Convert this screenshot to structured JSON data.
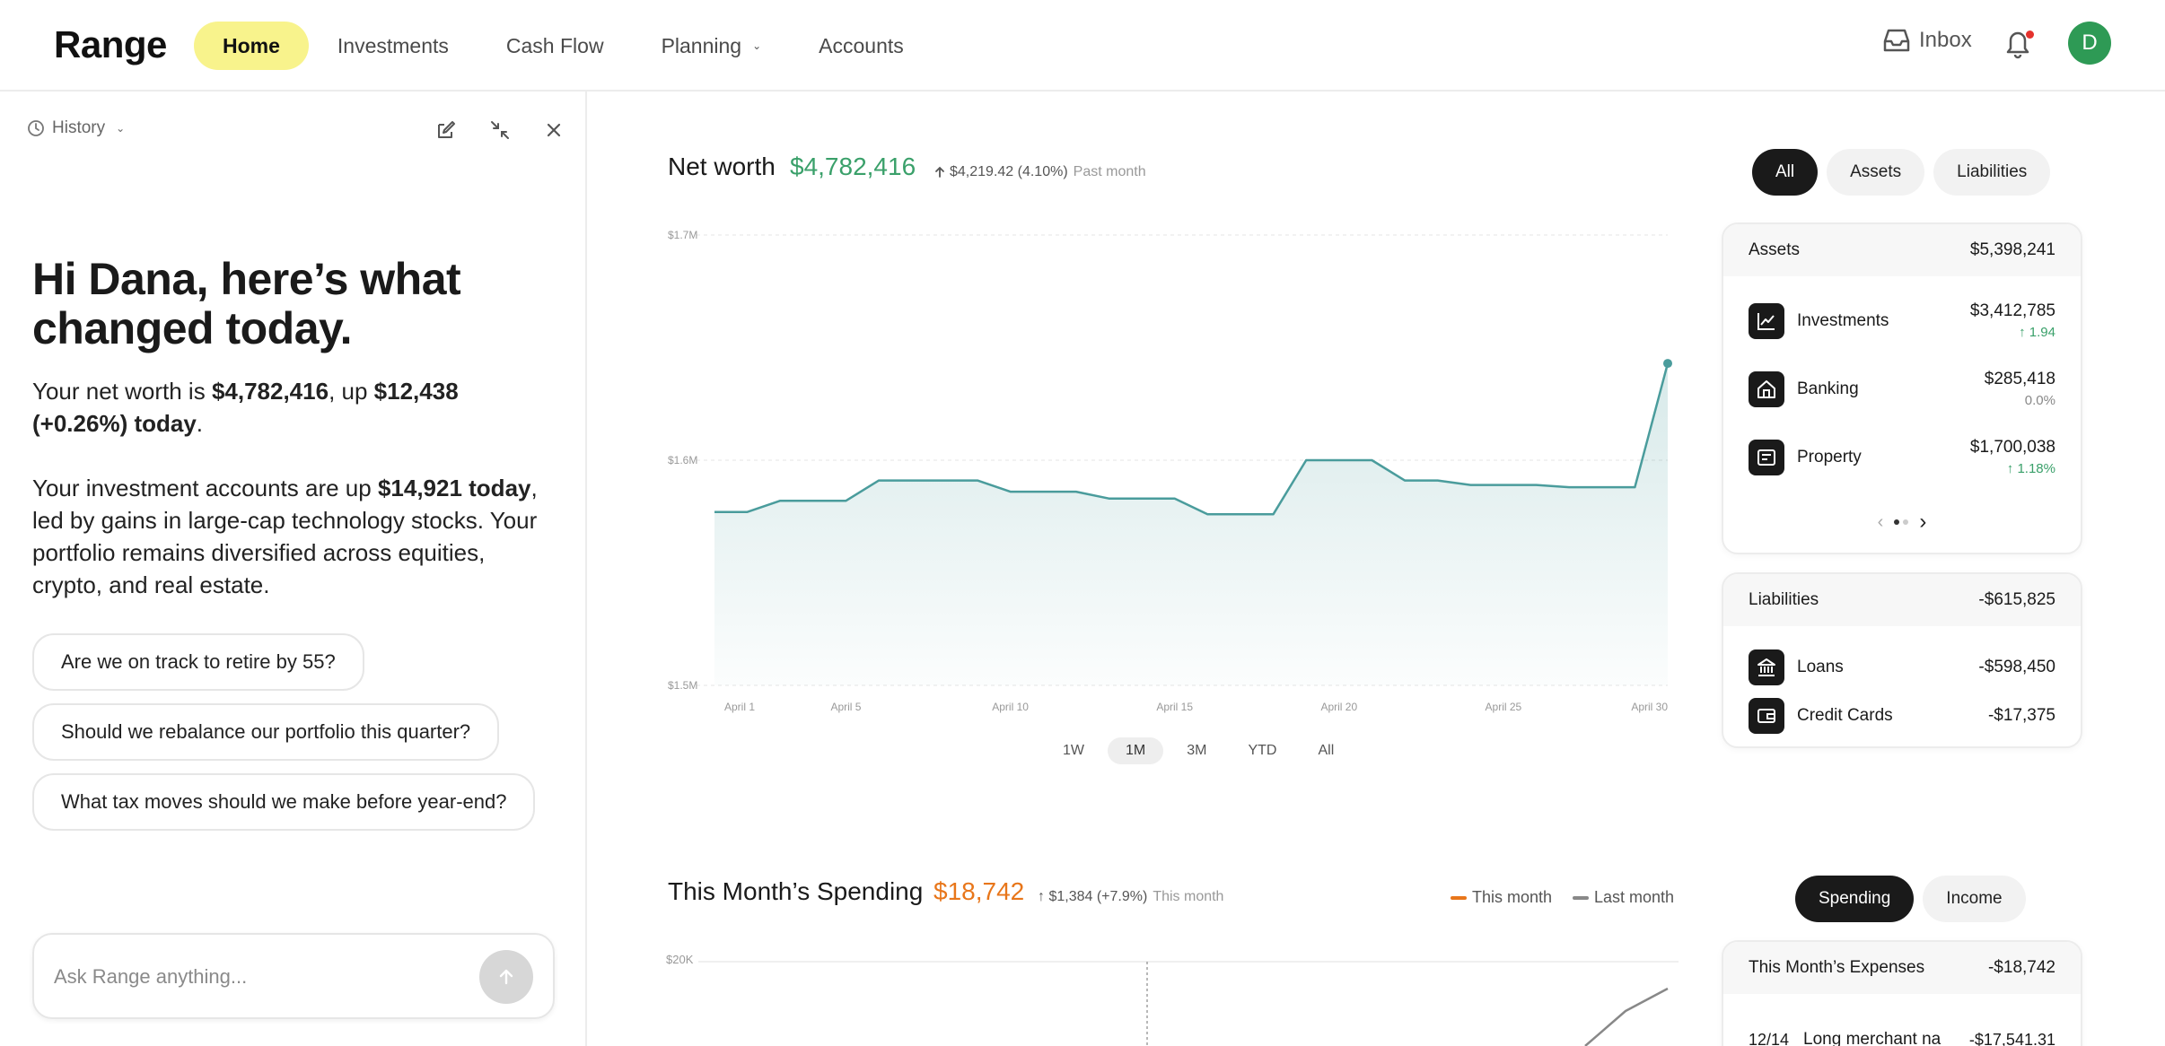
{
  "app": {
    "logo": "Range"
  },
  "nav": {
    "items": [
      {
        "label": "Home"
      },
      {
        "label": "Investments"
      },
      {
        "label": "Cash Flow"
      },
      {
        "label": "Planning"
      },
      {
        "label": "Accounts"
      }
    ],
    "inbox_label": "Inbox",
    "avatar_initial": "D"
  },
  "left_panel": {
    "history_label": "History",
    "greeting": "Hi Dana, here’s what changed today.",
    "para1": {
      "p1": "Your net worth is ",
      "b1": "$4,782,416",
      "p2": ", up ",
      "b2": "$12,438 (+0.26%) today",
      "p3": "."
    },
    "para2": {
      "p1": "Your investment accounts are up ",
      "b1": "$14,921 today",
      "p2": ", led by gains in large-cap technology stocks. Your portfolio remains diversified across equities, crypto, and real estate."
    },
    "suggestions": [
      "Are we on track to retire by 55?",
      "Should we rebalance our portfolio this quarter?",
      "What tax moves should we make before year-end?"
    ],
    "ask_placeholder": "Ask Range anything..."
  },
  "net_worth": {
    "title": "Net worth",
    "value": "$4,782,416",
    "change": "$4,219.42 (4.10%)",
    "period": "Past month",
    "filters": [
      "All",
      "Assets",
      "Liabilities"
    ],
    "ranges": [
      "1W",
      "1M",
      "3M",
      "YTD",
      "All"
    ],
    "active_range": "1M"
  },
  "chart_data": {
    "type": "area",
    "y_ticks": [
      "$1.7M",
      "$1.6M",
      "$1.5M"
    ],
    "ylim": [
      1500000,
      1700000
    ],
    "x_ticks": [
      "April 1",
      "April 5",
      "April 10",
      "April 15",
      "April 20",
      "April 25",
      "April 30"
    ],
    "x": [
      1,
      2,
      3,
      4,
      5,
      6,
      7,
      8,
      9,
      10,
      11,
      12,
      13,
      14,
      15,
      16,
      17,
      18,
      19,
      20,
      21,
      22,
      23,
      24,
      25,
      26,
      27,
      28,
      29,
      30
    ],
    "values": [
      1577000,
      1577000,
      1582000,
      1582000,
      1582000,
      1591000,
      1591000,
      1591000,
      1591000,
      1586000,
      1586000,
      1586000,
      1583000,
      1583000,
      1583000,
      1576000,
      1576000,
      1576000,
      1600000,
      1600000,
      1600000,
      1591000,
      1591000,
      1589000,
      1589000,
      1589000,
      1588000,
      1588000,
      1588000,
      1643000
    ],
    "color": "#4a9c9c"
  },
  "assets_card": {
    "title": "Assets",
    "total": "$5,398,241",
    "rows": [
      {
        "icon": "chart-line-icon",
        "label": "Investments",
        "value": "$3,412,785",
        "delta": "1.94"
      },
      {
        "icon": "home-icon",
        "label": "Banking",
        "value": "$285,418",
        "delta": "0.0%"
      },
      {
        "icon": "property-icon",
        "label": "Property",
        "value": "$1,700,038",
        "delta": "1.18%"
      }
    ]
  },
  "liabilities_card": {
    "title": "Liabilities",
    "total": "-$615,825",
    "rows": [
      {
        "icon": "bank-icon",
        "label": "Loans",
        "value": "-$598,450"
      },
      {
        "icon": "wallet-icon",
        "label": "Credit Cards",
        "value": "-$17,375"
      }
    ]
  },
  "spending": {
    "title": "This Month’s Spending",
    "value": "$18,742",
    "change": "$1,384 (+7.9%)",
    "period": "This month",
    "legend": [
      "This month",
      "Last month"
    ],
    "toggle": [
      "Spending",
      "Income"
    ],
    "y_tick": "$20K",
    "expenses_card": {
      "title": "This Month’s Expenses",
      "total": "-$18,742",
      "first_row_date": "12/14",
      "first_row_label": "Long merchant na",
      "first_row_value": "-$17,541.31"
    }
  },
  "colors": {
    "accent_yellow": "#f8f38c",
    "positive_green": "#3aa06a",
    "spending_orange": "#e8761a",
    "chart_teal": "#4a9c9c",
    "avatar_green": "#2e9a55"
  }
}
